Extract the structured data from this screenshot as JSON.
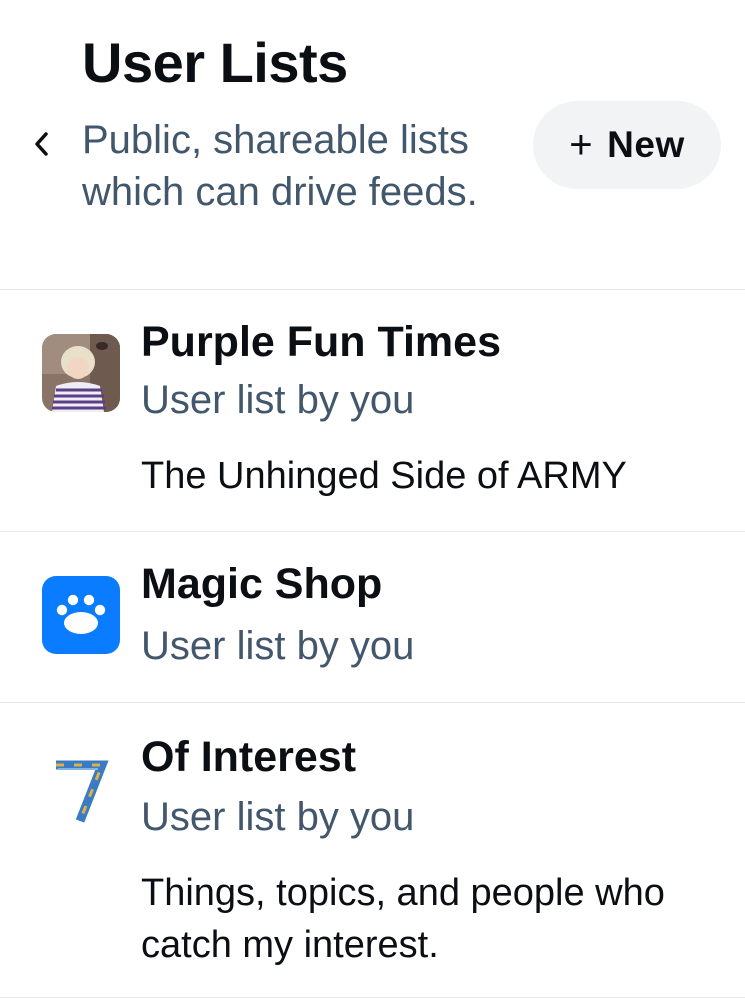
{
  "header": {
    "title": "User Lists",
    "subtitle": "Public, shareable lists which can drive feeds.",
    "back_icon": "chevron-left-icon",
    "new_button": {
      "plus": "+",
      "label": "New"
    }
  },
  "lists": [
    {
      "name": "Purple Fun Times",
      "subtitle": "User list by you",
      "description": "The Unhinged Side of ARMY",
      "avatar": "photo"
    },
    {
      "name": "Magic Shop",
      "subtitle": "User list by you",
      "description": "",
      "avatar": "paw-icon",
      "avatar_color": "#0a7cff"
    },
    {
      "name": "Of Interest",
      "subtitle": "User list by you",
      "description": "Things, topics, and people who catch my interest.",
      "avatar": "number-seven-image"
    }
  ],
  "colors": {
    "primary_text": "#0b0f14",
    "secondary_text": "#42576c",
    "divider": "#e6e9ec",
    "button_bg": "#f1f3f5",
    "accent": "#0a7cff"
  }
}
